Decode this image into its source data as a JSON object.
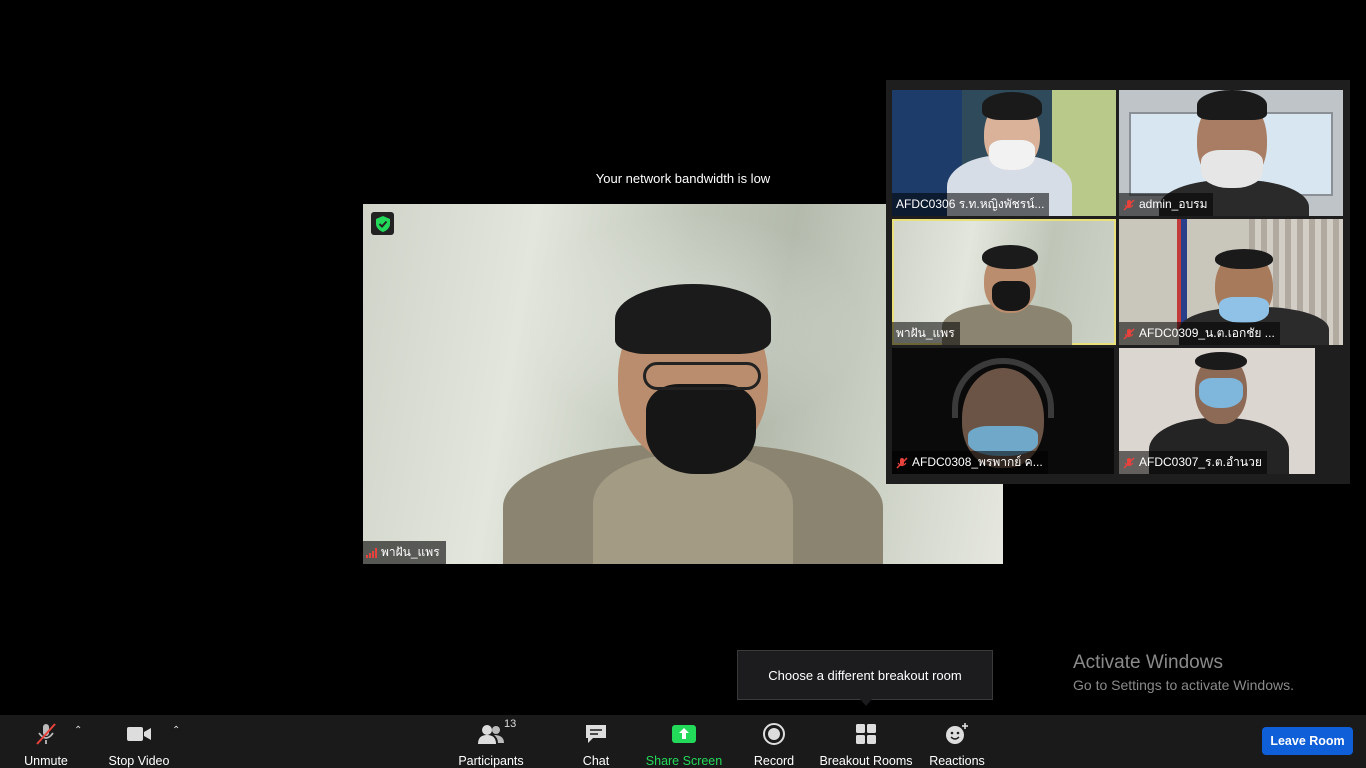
{
  "notice": "Your network bandwidth is low",
  "main_video": {
    "name": "พาฝัน_แพร"
  },
  "participants": [
    {
      "name": "AFDC0306 ร.ท.หญิงพัชรน์...",
      "muted": false
    },
    {
      "name": "admin_อบรม",
      "muted": true
    },
    {
      "name": "พาฝัน_แพร",
      "muted": false,
      "active": true
    },
    {
      "name": "AFDC0309_น.ต.เอกชัย ...",
      "muted": true
    },
    {
      "name": "AFDC0308_พรพากย์ ค...",
      "muted": true
    },
    {
      "name": "AFDC0307_ร.ต.อำนวย",
      "muted": true
    }
  ],
  "tooltip": "Choose a different breakout room",
  "watermark": {
    "title": "Activate Windows",
    "subtitle": "Go to Settings to activate Windows."
  },
  "toolbar": {
    "unmute": "Unmute",
    "stop_video": "Stop Video",
    "participants": "Participants",
    "participants_count": "13",
    "chat": "Chat",
    "share_screen": "Share Screen",
    "record": "Record",
    "breakout_rooms": "Breakout Rooms",
    "reactions": "Reactions",
    "leave_room": "Leave Room"
  },
  "colors": {
    "share_green": "#23d959",
    "leave_blue": "#0e5fd8",
    "muted_red": "#e8423c",
    "active_border": "#e8e07a"
  }
}
